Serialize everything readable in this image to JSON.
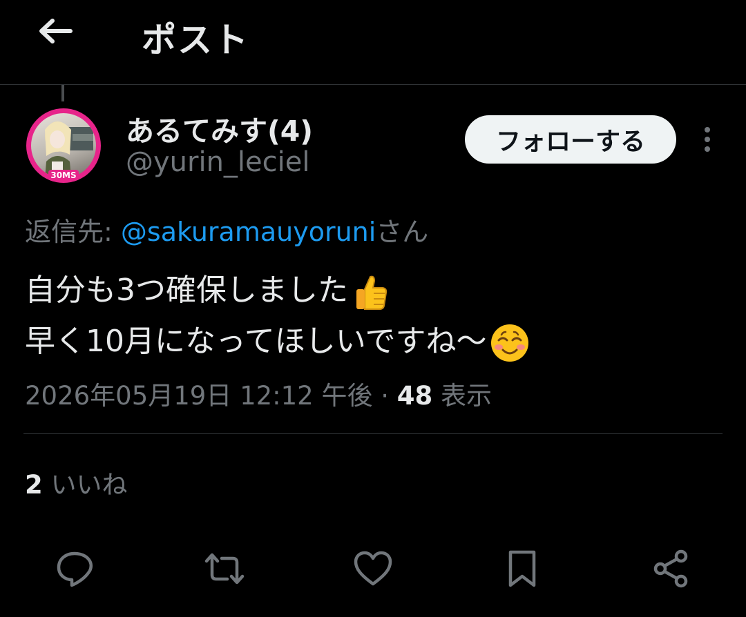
{
  "header": {
    "title": "ポスト"
  },
  "author": {
    "display_name": "あるてみす(4)",
    "handle": "@yurin_leciel",
    "avatar_badge": "30MS"
  },
  "follow_button": {
    "label": "フォローする"
  },
  "reply_to": {
    "prefix": "返信先:",
    "mention": "@sakuramauyoruni",
    "suffix": "さん"
  },
  "tweet": {
    "line1": "自分も3つ確保しました",
    "line2": "早く10月になってほしいですね～",
    "emojis": [
      "thumbs-up",
      "smiling-face"
    ]
  },
  "meta": {
    "datetime": "2026年05月19日 12:12 午後",
    "separator": " · ",
    "views_count": "48",
    "views_label": "表示"
  },
  "stats": {
    "likes_count": "2",
    "likes_label": "いいね"
  },
  "actions": [
    "reply-icon",
    "retweet-icon",
    "like-icon",
    "bookmark-icon",
    "share-icon"
  ],
  "colors": {
    "background": "#000000",
    "text": "#e7e9ea",
    "secondary": "#71767b",
    "link": "#1d9bf0",
    "avatar_ring": "#e7248a"
  }
}
